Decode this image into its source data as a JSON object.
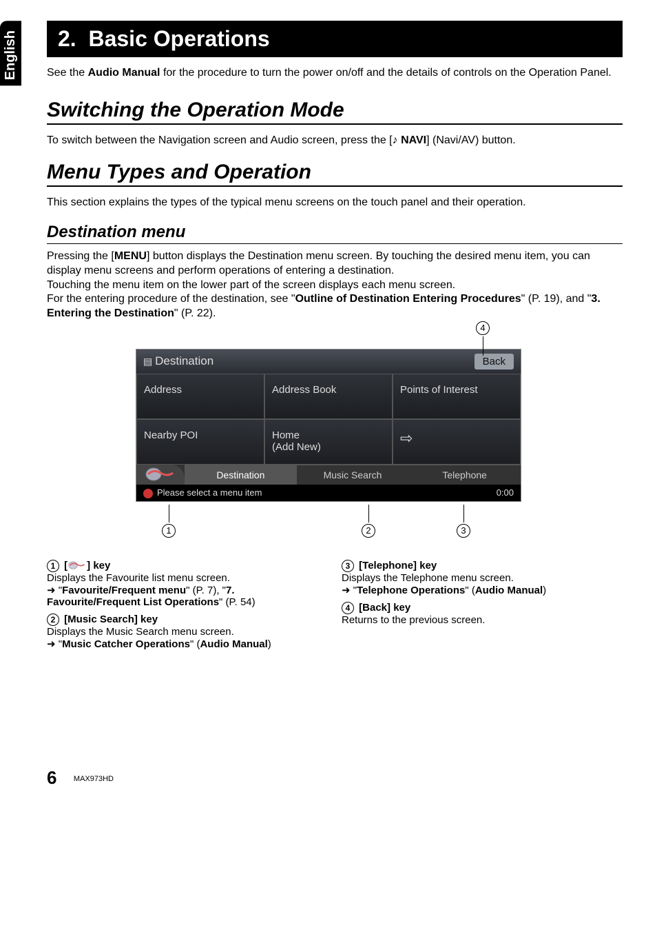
{
  "lang_tab": "English",
  "chapter": {
    "num": "2.",
    "title": "Basic Operations"
  },
  "intro": {
    "pre": "See the ",
    "bold": "Audio Manual",
    "post": " for the procedure to turn the power on/off and the details of controls on the Operation Panel."
  },
  "section1": {
    "heading": "Switching the Operation Mode",
    "para_pre": "To switch between the Navigation screen and Audio screen, press the [",
    "navi": "NAVI",
    "para_post": "] (Navi/AV) button."
  },
  "section2": {
    "heading": "Menu Types and Operation",
    "para": "This section explains the types of the typical menu screens on the touch panel and their operation."
  },
  "sub1": {
    "heading": "Destination menu",
    "line1_pre": "Pressing the [",
    "line1_bold": "MENU",
    "line1_post": "] button displays the Destination menu screen. By touching the desired menu item, you can display menu screens and perform operations of entering a destination.",
    "line2": "Touching the menu item on the lower part of the screen displays each menu screen.",
    "line3_pre": "For the entering procedure of the destination, see \"",
    "line3_bold1": "Outline of Destination Entering Procedures",
    "line3_mid": "\" (P. 19), and \"",
    "line3_bold2": "3. Entering the Destination",
    "line3_post": "\" (P. 22)."
  },
  "callouts": {
    "c1": "1",
    "c2": "2",
    "c3": "3",
    "c4": "4"
  },
  "ui": {
    "title": "Destination",
    "back": "Back",
    "cells": {
      "address": "Address",
      "addressbook": "Address Book",
      "poi": "Points of Interest",
      "nearby": "Nearby POI",
      "home": "Home\n(Add New)",
      "arrow": "⇨"
    },
    "tabs": {
      "dest": "Destination",
      "music": "Music Search",
      "tel": "Telephone"
    },
    "status": {
      "msg": "Please select a menu item",
      "time": "0:00"
    }
  },
  "keys": {
    "k1": {
      "head_pre": "[",
      "head_post": "] key",
      "line": "Displays the Favourite list menu screen.",
      "ref_pre": "\"",
      "ref_b1": "Favourite/Frequent menu",
      "ref_mid1": "\" (P. 7), \"",
      "ref_b2": "7. Favourite/Frequent List Operations",
      "ref_post": "\" (P. 54)"
    },
    "k2": {
      "head": "[Music Search] key",
      "line": "Displays the Music Search menu screen.",
      "ref_pre": "\"",
      "ref_b": "Music Catcher Operations",
      "ref_mid": "\" (",
      "ref_b2": "Audio Manual",
      "ref_post": ")"
    },
    "k3": {
      "head": "[Telephone] key",
      "line": "Displays the Telephone menu screen.",
      "ref_pre": "\"",
      "ref_b": "Telephone Operations",
      "ref_mid": "\" (",
      "ref_b2": "Audio Manual",
      "ref_post": ")"
    },
    "k4": {
      "head": "[Back] key",
      "line": "Returns to the previous screen."
    }
  },
  "footer": {
    "page": "6",
    "model": "MAX973HD"
  }
}
